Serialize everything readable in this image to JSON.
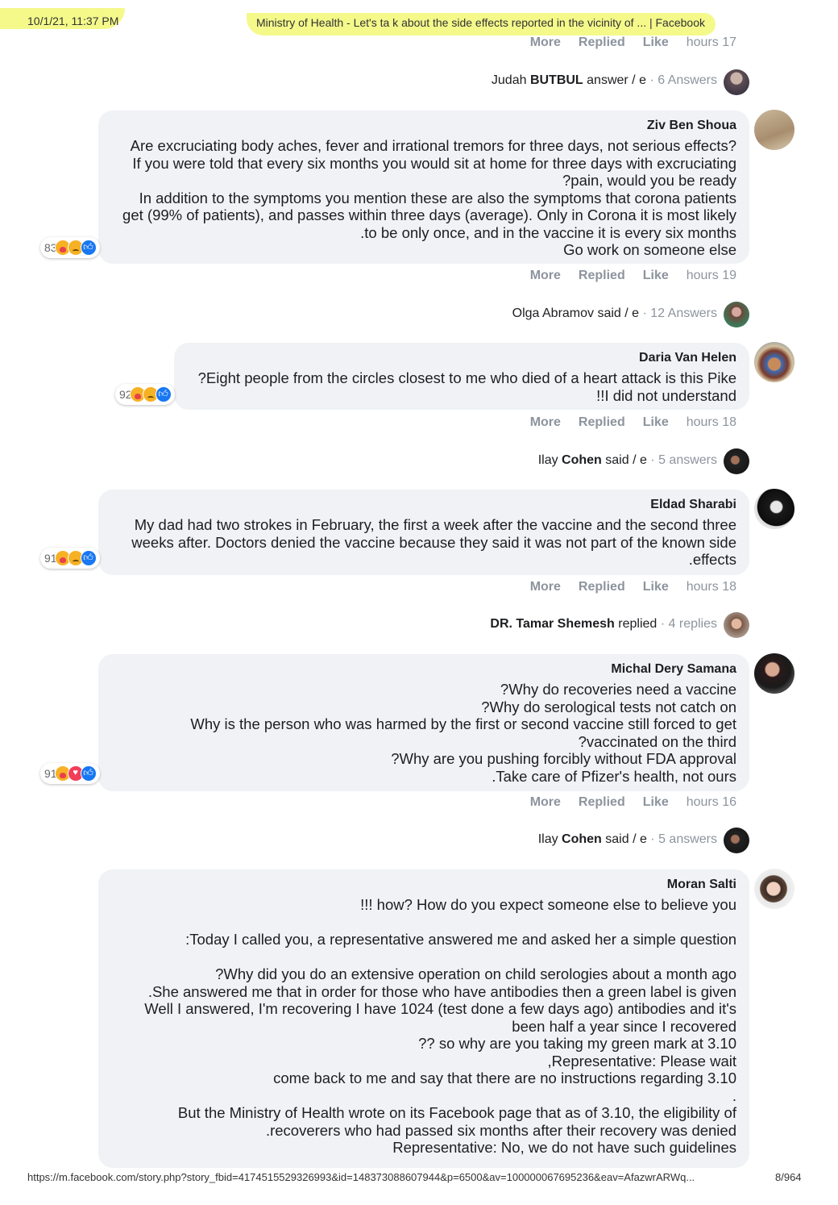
{
  "header": {
    "date": "10/1/21, 11:37 PM",
    "title": "Ministry of Health - Let's ta k about the side effects reported in the vicinity of ... | Facebook"
  },
  "footer": {
    "url": "https://m.facebook.com/story.php?story_fbid=4174515529326993&id=148373088607944&p=6500&av=100000067695236&eav=AfazwrARWq...",
    "page": "8/964"
  },
  "actions": {
    "more": "More",
    "replied": "Replied",
    "like": "Like"
  },
  "action_rows": [
    {
      "time": "hours 17"
    },
    {
      "time": "hours 19"
    },
    {
      "time": "hours 18"
    },
    {
      "time": "hours 18"
    },
    {
      "time": "hours 16"
    }
  ],
  "replies": [
    {
      "pre": "Judah ",
      "name": "BUTBUL",
      "post": " answer / e",
      "count": " · 6 Answers"
    },
    {
      "pre": "",
      "name": "Olga Abramov",
      "post": " said / e",
      "count": " · 12 Answers"
    },
    {
      "pre": "Ilay ",
      "name": "Cohen",
      "post": " said / e",
      "count": " · 5 answers"
    },
    {
      "pre": "",
      "name": "DR. Tamar Shemesh",
      "post": " replied",
      "count": " · 4 replies"
    },
    {
      "pre": "Ilay ",
      "name": "Cohen",
      "post": " said / e",
      "count": " · 5 answers"
    }
  ],
  "comments": [
    {
      "author": "Ziv Ben Shoua",
      "reactions": "83",
      "lines": [
        "Are excruciating body aches, fever and irrational tremors for three days, not serious effects?",
        "If you were told that every six months you would sit at home for three days with excruciating",
        "?pain, would you be ready",
        "In addition to the symptoms you mention these are also the symptoms that corona patients",
        "get (99% of patients), and passes within three days (average). Only in Corona it is most likely",
        ".to be only once, and in the vaccine it is every six months",
        "Go work on someone else"
      ]
    },
    {
      "author": "Daria Van Helen",
      "reactions": "92",
      "lines": [
        "?Eight people from the circles closest to me who died of a heart attack is this Pike",
        "!!I did not understand"
      ]
    },
    {
      "author": "Eldad Sharabi",
      "reactions": "91",
      "lines": [
        "My dad had two strokes in February, the first a week after the vaccine and the second three",
        "weeks after. Doctors denied the vaccine because they said it was not part of the known side",
        ".effects"
      ]
    },
    {
      "author": "Michal Dery Samana",
      "reactions": "91",
      "lines": [
        "?Why do recoveries need a vaccine",
        "?Why do serological tests not catch on",
        "Why is the person who was harmed by the first or second vaccine still forced to get",
        "?vaccinated on the third",
        "?Why are you pushing forcibly without FDA approval",
        ".Take care of Pfizer's health, not ours"
      ]
    },
    {
      "author": "Moran Salti",
      "lines": [
        "!!! how? How do you expect someone else to believe you",
        " ",
        ":Today I called you, a representative answered me and asked her a simple question",
        " ",
        "?Why did you do an extensive operation on child serologies about a month ago",
        ".She answered me that in order for those who have antibodies then a green label is given",
        "Well I answered, I'm recovering I have 1024 (test done a few days ago) antibodies and it's",
        "been half a year since I recovered",
        "?? so why are you taking my green mark at 3.10",
        ",Representative: Please wait",
        "come back to me and say that there are no instructions regarding 3.10",
        ".",
        "But the Ministry of Health wrote on its Facebook page that as of 3.10, the eligibility of",
        ".recoverers who had passed six months after their recovery was denied",
        "Representative: No, we do not have such guidelines"
      ]
    }
  ]
}
